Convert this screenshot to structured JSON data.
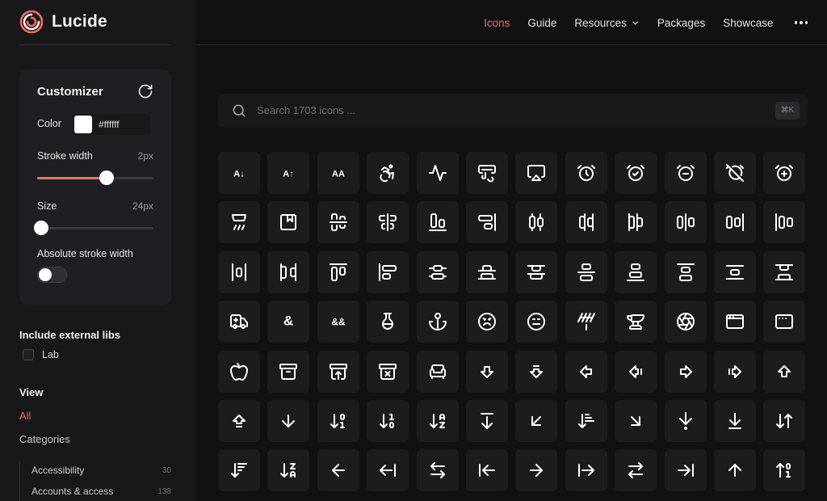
{
  "brand": {
    "name": "Lucide",
    "accent": "#f26a61"
  },
  "nav": {
    "items": [
      {
        "label": "Icons",
        "active": true
      },
      {
        "label": "Guide"
      },
      {
        "label": "Resources",
        "dropdown": true
      },
      {
        "label": "Packages"
      },
      {
        "label": "Showcase"
      }
    ]
  },
  "customizer": {
    "title": "Customizer",
    "color_label": "Color",
    "color_value": "#ffffff",
    "stroke_label": "Stroke width",
    "stroke_value": "2px",
    "stroke_fraction": 0.6,
    "size_label": "Size",
    "size_value": "24px",
    "size_fraction": 0,
    "absolute_label": "Absolute stroke width",
    "absolute_on": false
  },
  "external": {
    "title": "Include external libs",
    "lab_label": "Lab"
  },
  "view": {
    "title": "View",
    "all": "All",
    "categories": "Categories",
    "items": [
      {
        "label": "Accessibility",
        "count": "30"
      },
      {
        "label": "Accounts & access",
        "count": "138"
      }
    ]
  },
  "search": {
    "placeholder": "Search 1703 icons ...",
    "shortcut": "⌘K"
  },
  "icons": [
    "a-arrow-down-icon",
    "a-arrow-up-icon",
    "a-large-small-icon",
    "accessibility-icon",
    "activity-icon",
    "air-vent-icon",
    "airplay-icon",
    "alarm-clock-icon",
    "alarm-clock-check-icon",
    "alarm-clock-minus-icon",
    "alarm-clock-off-icon",
    "alarm-clock-plus-icon",
    "alarm-smoke-icon",
    "album-icon",
    "align-center-horizontal-icon",
    "align-center-vertical-icon",
    "align-end-horizontal-icon",
    "align-end-vertical-icon",
    "align-horizontal-distribute-center-icon",
    "align-horizontal-distribute-end-icon",
    "align-horizontal-distribute-start-icon",
    "align-horizontal-justify-center-icon",
    "align-horizontal-justify-end-icon",
    "align-horizontal-justify-start-icon",
    "align-horizontal-space-around-icon",
    "align-horizontal-space-between-icon",
    "align-start-horizontal-icon",
    "align-start-vertical-icon",
    "align-vertical-distribute-center-icon",
    "align-vertical-distribute-end-icon",
    "align-vertical-distribute-start-icon",
    "align-vertical-justify-center-icon",
    "align-vertical-justify-end-icon",
    "align-vertical-justify-start-icon",
    "align-vertical-space-around-icon",
    "align-vertical-space-between-icon",
    "ambulance-icon",
    "ampersand-icon",
    "ampersands-icon",
    "amphora-icon",
    "anchor-icon",
    "angry-icon",
    "annoyed-icon",
    "antenna-icon",
    "anvil-icon",
    "aperture-icon",
    "app-window-icon",
    "app-window-mac-icon",
    "apple-icon",
    "archive-icon",
    "archive-restore-icon",
    "archive-x-icon",
    "armchair-icon",
    "arrow-big-down-icon",
    "arrow-big-down-dash-icon",
    "arrow-big-left-icon",
    "arrow-big-left-dash-icon",
    "arrow-big-right-icon",
    "arrow-big-right-dash-icon",
    "arrow-big-up-icon",
    "arrow-big-up-dash-icon",
    "arrow-down-icon",
    "arrow-down-0-1-icon",
    "arrow-down-1-0-icon",
    "arrow-down-a-z-icon",
    "arrow-down-from-line-icon",
    "arrow-down-left-icon",
    "arrow-down-narrow-wide-icon",
    "arrow-down-right-icon",
    "arrow-down-to-dot-icon",
    "arrow-down-to-line-icon",
    "arrow-down-up-icon",
    "arrow-down-wide-narrow-icon",
    "arrow-down-z-a-icon",
    "arrow-left-icon",
    "arrow-left-from-line-icon",
    "arrow-left-right-icon",
    "arrow-left-to-line-icon",
    "arrow-right-icon",
    "arrow-right-from-line-icon",
    "arrow-right-left-icon",
    "arrow-right-to-line-icon",
    "arrow-up-icon",
    "arrow-up-0-1-icon"
  ]
}
